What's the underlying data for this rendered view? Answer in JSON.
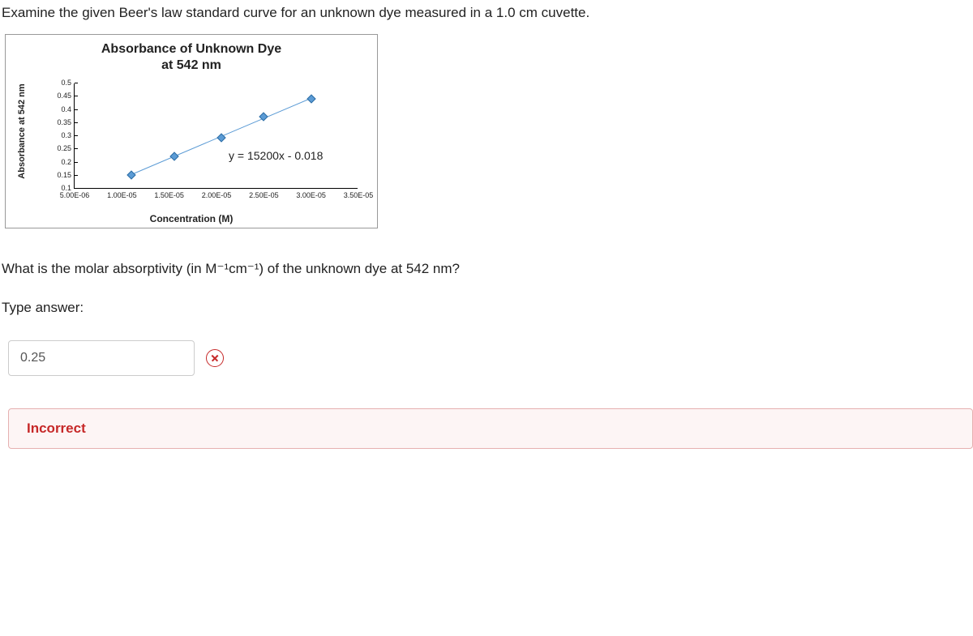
{
  "prompt": "Examine the given Beer's law standard curve for an unknown dye measured in a 1.0 cm cuvette.",
  "question": "What is the molar absorptivity (in M⁻¹cm⁻¹) of the unknown dye at 542 nm?",
  "type_answer_label": "Type answer:",
  "answer_value": "0.25",
  "feedback": "Incorrect",
  "chart_data": {
    "type": "scatter",
    "title_line1": "Absorbance of Unknown Dye",
    "title_line2": "at 542 nm",
    "xlabel": "Concentration (M)",
    "ylabel": "Absorbance at 542 nm",
    "equation": "y = 15200x - 0.018",
    "x_ticks": [
      "5.00E-06",
      "1.00E-05",
      "1.50E-05",
      "2.00E-05",
      "2.50E-05",
      "3.00E-05",
      "3.50E-05"
    ],
    "y_ticks": [
      "0.1",
      "0.15",
      "0.2",
      "0.25",
      "0.3",
      "0.35",
      "0.4",
      "0.45",
      "0.5"
    ],
    "xlim": [
      5e-06,
      3.5e-05
    ],
    "ylim": [
      0.1,
      0.5
    ],
    "points": [
      {
        "x": 1.1e-05,
        "y": 0.15
      },
      {
        "x": 1.55e-05,
        "y": 0.22
      },
      {
        "x": 2.05e-05,
        "y": 0.29
      },
      {
        "x": 2.5e-05,
        "y": 0.37
      },
      {
        "x": 3e-05,
        "y": 0.44
      }
    ]
  }
}
